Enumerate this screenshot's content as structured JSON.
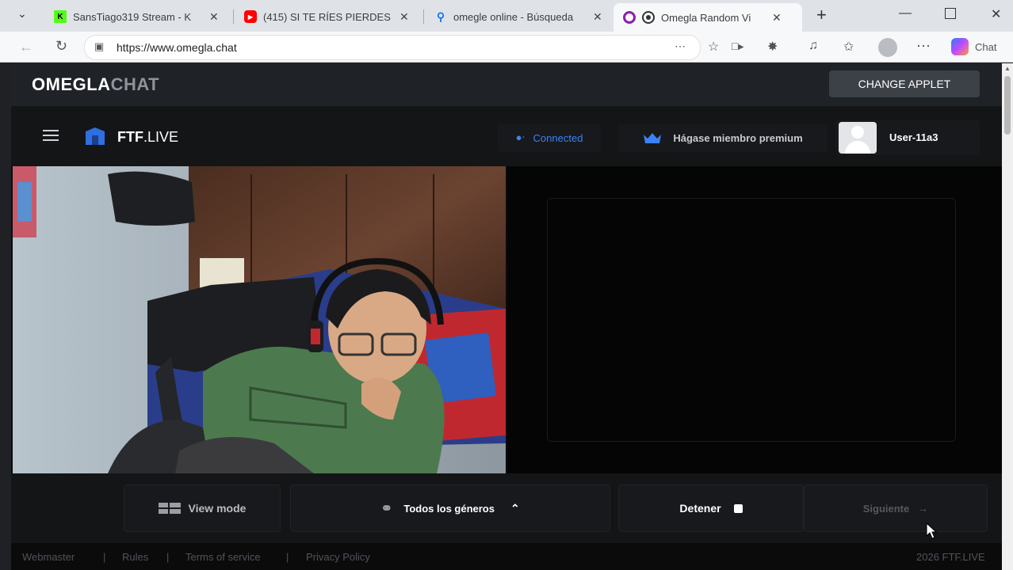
{
  "browser": {
    "tabs": [
      {
        "label": "SansTiago319 Stream - K",
        "icon": "kick-icon",
        "color": "#53fc18"
      },
      {
        "label": "(415) SI TE RÍES PIERDES",
        "icon": "youtube-icon",
        "color": "#ff0000"
      },
      {
        "label": "omegle online - Búsqueda",
        "icon": "search-icon",
        "color": "#1a73e8"
      },
      {
        "label": "Omegla Random Vi",
        "icon": "omegla-icon",
        "color": "#8b1fa9",
        "active": true
      }
    ],
    "url": "https://www.omegla.chat",
    "copilot_label": "Chat"
  },
  "site": {
    "logo_main": "OMEGLA",
    "logo_sub": "CHAT",
    "change_applet": "CHANGE APPLET"
  },
  "app": {
    "brand_bold": "FTF",
    "brand_rest": ".LIVE",
    "status": "Connected",
    "premium": "Hágase miembro premium",
    "username": "User-11a3",
    "accent": "#3b82f6"
  },
  "controls": {
    "view_mode": "View mode",
    "genders": "Todos los géneros",
    "stop": "Detener",
    "next": "Siguiente"
  },
  "footer": {
    "links": [
      "Webmaster",
      "Rules",
      "Terms of service",
      "Privacy Policy"
    ],
    "separator": "|",
    "copyright": "2026 FTF.LIVE"
  }
}
